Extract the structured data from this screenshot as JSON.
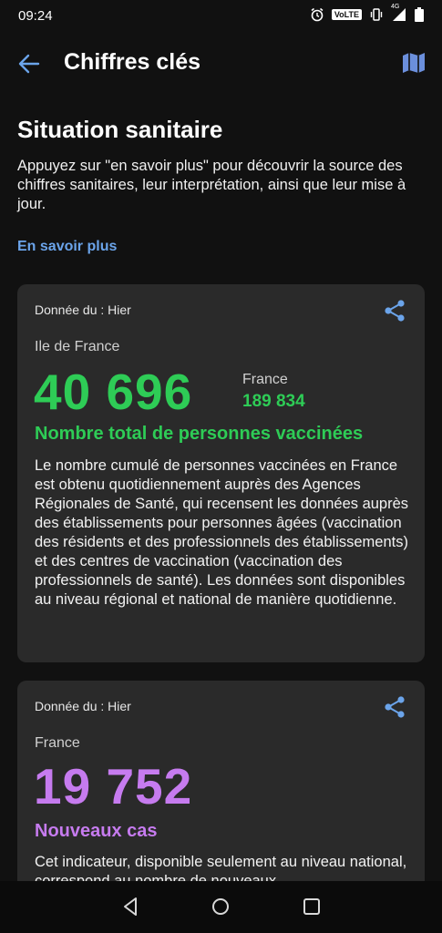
{
  "status": {
    "time": "09:24",
    "volte": "VoLTE",
    "network": "4G"
  },
  "appbar": {
    "title": "Chiffres clés"
  },
  "section": {
    "title": "Situation sanitaire",
    "description": "Appuyez sur \"en savoir plus\" pour découvrir la source des chiffres sanitaires, leur interprétation, ainsi que leur mise à jour.",
    "learn_more": "En savoir plus"
  },
  "cards": [
    {
      "date": "Donnée du : Hier",
      "region": "Ile de France",
      "value": "40 696",
      "national_label": "France",
      "national_value": "189 834",
      "indicator": "Nombre total de personnes vaccinées",
      "description": "Le nombre cumulé de personnes vaccinées en France est obtenu quotidiennement auprès des Agences Régionales de Santé, qui recensent les données auprès des établissements pour personnes âgées (vaccination des résidents et des professionnels des établissements) et des centres de vaccination (vaccination des professionnels de santé). Les données sont disponibles au niveau régional et national de manière quotidienne."
    },
    {
      "date": "Donnée du : Hier",
      "region": "France",
      "value": "19 752",
      "indicator": "Nouveaux cas",
      "description": "Cet indicateur, disponible seulement au niveau national, correspond au nombre de nouveaux"
    }
  ],
  "colors": {
    "accent_green": "#2ecc56",
    "accent_purple": "#c67bef",
    "link_blue": "#6ba4ea"
  }
}
